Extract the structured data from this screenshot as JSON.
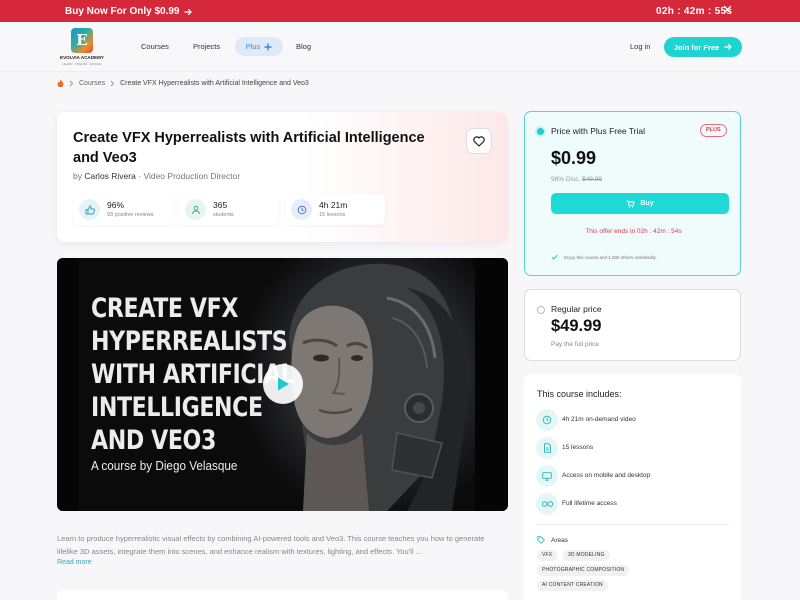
{
  "promo": {
    "buy_label": "Buy Now For Only $0.99",
    "timer": "02h : 42m : 55s"
  },
  "header": {
    "logo_name": "EVOLVIA ACADEMY",
    "logo_tagline": "LEARN · CREATE · EVOLVE",
    "logo_letter": "E",
    "nav": [
      "Courses",
      "Projects",
      "Plus",
      "Blog"
    ],
    "login": "Log in",
    "join": "Join for Free"
  },
  "breadcrumb": {
    "items": [
      "Courses",
      "Create VFX Hyperrealists with Artificial Intelligence and Veo3"
    ]
  },
  "course": {
    "title": "Create VFX Hyperrealists with Artificial Intelligence and Veo3",
    "by": "by",
    "author": "Carlos Rivera",
    "sep": "·",
    "role": "Video Production Director",
    "stats": [
      {
        "value": "96%",
        "label": "93 positive reviews"
      },
      {
        "value": "365",
        "label": "students"
      },
      {
        "value": "4h 21m",
        "label": "15 lessons"
      }
    ],
    "video_title_lines": [
      "CREATE VFX",
      "HYPERREALISTS",
      "WITH ARTIFICIAL",
      "INTELLIGENCE",
      "AND VEO3"
    ],
    "video_subtitle": "A course by Diego Velasque",
    "description": "Learn to produce hyperrealistic visual effects by combining AI-powered tools and Veo3. This course teaches you how to generate lifelike 3D assets, integrate them into scenes, and enhance realism with textures, lighting, and effects. You'll ...",
    "read_more": "Read more"
  },
  "plus_offer": {
    "label": "Price with Plus Free Trial",
    "badge": "PLUS",
    "price": "$0.99",
    "discount": "98% Disc.",
    "original_price": "$49.99",
    "buy_label": "Buy",
    "offer_text": "This offer ends in 02h : 42m : 54s",
    "enjoy_text": "Enjoy this course and 1,000 others unlimitedly."
  },
  "regular_offer": {
    "label": "Regular price",
    "price": "$49.99",
    "note": "Pay the full price"
  },
  "includes": {
    "title": "This course includes:",
    "items": [
      {
        "icon": "clock-icon",
        "text": "4h 21m on-demand video"
      },
      {
        "icon": "document-icon",
        "text": "15 lessons"
      },
      {
        "icon": "monitor-icon",
        "text": "Access on mobile and desktop"
      },
      {
        "icon": "infinity-icon",
        "text": "Full lifetime access"
      }
    ],
    "areas_label": "Areas",
    "areas": [
      "VFX",
      "3D MODELING",
      "PHOTOGRAPHIC COMPOSITION",
      "AI CONTENT CREATION"
    ]
  },
  "colors": {
    "promo_red": "#d6283b",
    "accent_teal": "#1ed4d0",
    "offer_red": "#e2394f"
  }
}
